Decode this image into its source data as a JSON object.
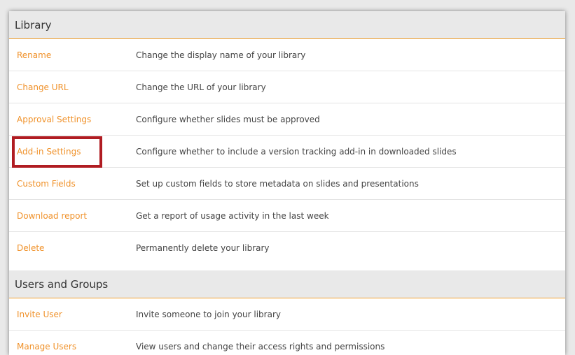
{
  "colors": {
    "link": "#f0922b",
    "header_bg": "#e9e9e9",
    "header_underline": "#f0a030",
    "highlight": "#b01c22"
  },
  "library": {
    "title": "Library",
    "items": [
      {
        "label": "Rename",
        "description": "Change the display name of your library"
      },
      {
        "label": "Change URL",
        "description": "Change the URL of your library"
      },
      {
        "label": "Approval Settings",
        "description": "Configure whether slides must be approved"
      },
      {
        "label": "Add-in Settings",
        "description": "Configure whether to include a version tracking add-in in downloaded slides"
      },
      {
        "label": "Custom Fields",
        "description": "Set up custom fields to store metadata on slides and presentations"
      },
      {
        "label": "Download report",
        "description": "Get a report of usage activity in the last week"
      },
      {
        "label": "Delete",
        "description": "Permanently delete your library"
      }
    ]
  },
  "users_groups": {
    "title": "Users and Groups",
    "items": [
      {
        "label": "Invite User",
        "description": "Invite someone to join your library"
      },
      {
        "label": "Manage Users",
        "description": "View users and change their access rights and permissions"
      }
    ]
  }
}
